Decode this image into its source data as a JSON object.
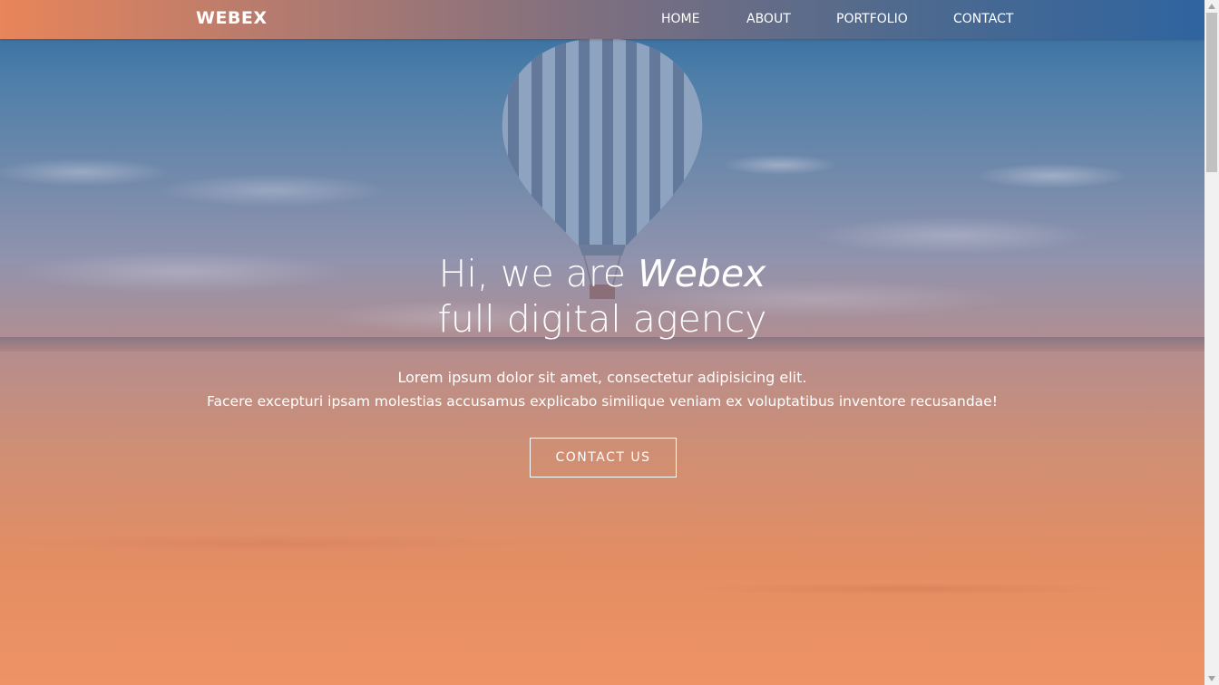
{
  "nav": {
    "brand": "WEBEX",
    "links": [
      "HOME",
      "ABOUT",
      "PORTFOLIO",
      "CONTACT"
    ]
  },
  "hero": {
    "title_prefix": "Hi, we are",
    "title_emphasis": "Webex",
    "title_line2": "full digital agency",
    "text_line1": "Lorem ipsum dolor sit amet, consectetur adipisicing elit.",
    "text_line2": "Facere excepturi ipsam molestias accusamus explicabo similique veniam ex voluptatibus inventore recusandae!",
    "cta_label": "CONTACT US"
  },
  "colors": {
    "gradient_start": "#e8855a",
    "gradient_end": "#2f64a0",
    "text": "#ffffff"
  }
}
